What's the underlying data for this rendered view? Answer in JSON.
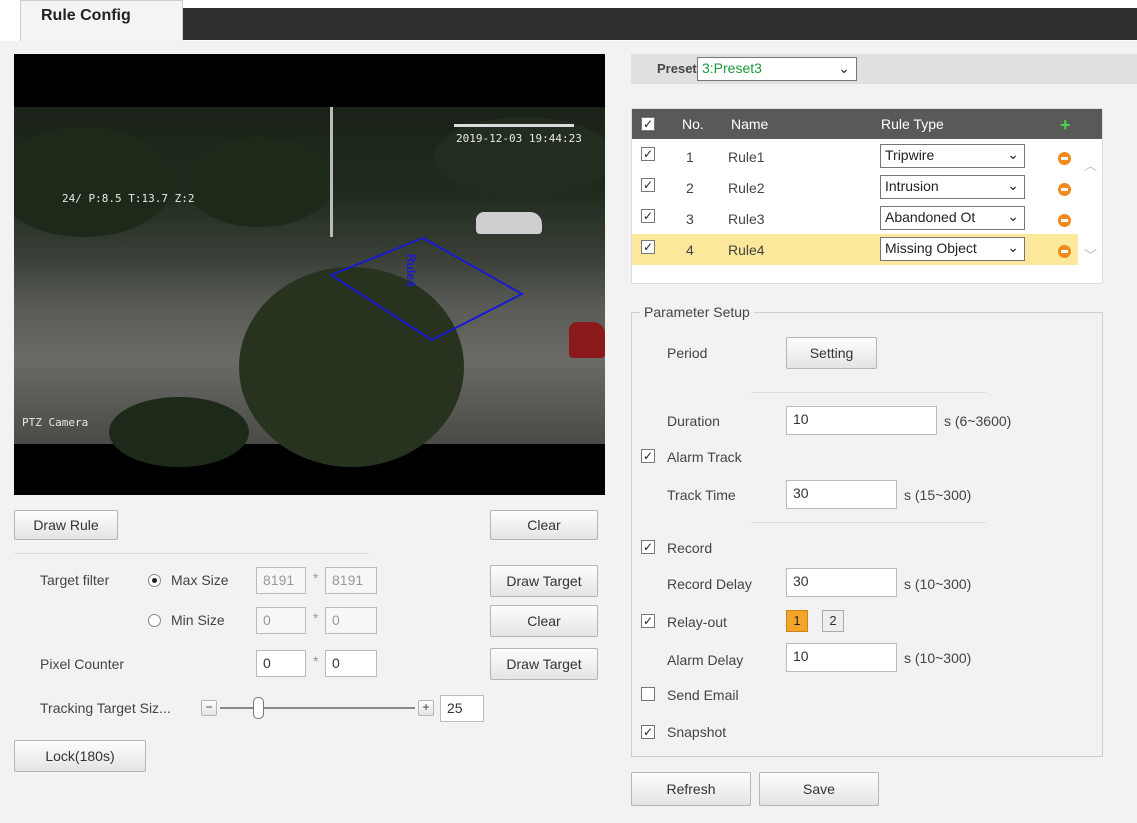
{
  "tab": {
    "title": "Rule Config"
  },
  "video": {
    "timestamp": "2019-12-03 19:44:23",
    "ptz_info": "24/ P:8.5 T:13.7 Z:2",
    "camera_name": "PTZ Camera",
    "rule_label": "Rule4",
    "rule_color": "#1a1ad0"
  },
  "left_controls": {
    "draw_rule": "Draw Rule",
    "clear1": "Clear",
    "target_filter_label": "Target filter",
    "max_size_label": "Max Size",
    "max_w": "8191",
    "max_h": "8191",
    "draw_target1": "Draw Target",
    "min_size_label": "Min Size",
    "min_w": "0",
    "min_h": "0",
    "clear2": "Clear",
    "pixel_counter_label": "Pixel Counter",
    "pix_w": "0",
    "pix_h": "0",
    "draw_target2": "Draw Target",
    "tracking_label": "Tracking Target Siz...",
    "tracking_value": "25",
    "lock": "Lock(180s)",
    "separator": "*"
  },
  "preset": {
    "label": "Preset",
    "value": "3:Preset3"
  },
  "rules_table": {
    "headers": {
      "no": "No.",
      "name": "Name",
      "type": "Rule Type"
    },
    "rows": [
      {
        "no": "1",
        "name": "Rule1",
        "type": "Tripwire",
        "checked": true
      },
      {
        "no": "2",
        "name": "Rule2",
        "type": "Intrusion",
        "checked": true
      },
      {
        "no": "3",
        "name": "Rule3",
        "type": "Abandoned Ot",
        "checked": true
      },
      {
        "no": "4",
        "name": "Rule4",
        "type": "Missing Object",
        "checked": true
      }
    ]
  },
  "params": {
    "legend": "Parameter Setup",
    "period_label": "Period",
    "setting_btn": "Setting",
    "duration_label": "Duration",
    "duration_value": "10",
    "duration_range": "s (6~3600)",
    "alarm_track_label": "Alarm Track",
    "track_time_label": "Track Time",
    "track_time_value": "30",
    "track_time_range": "s (15~300)",
    "record_label": "Record",
    "record_delay_label": "Record Delay",
    "record_delay_value": "30",
    "record_delay_range": "s (10~300)",
    "relay_out_label": "Relay-out",
    "relay_1": "1",
    "relay_2": "2",
    "alarm_delay_label": "Alarm Delay",
    "alarm_delay_value": "10",
    "alarm_delay_range": "s (10~300)",
    "send_email_label": "Send Email",
    "snapshot_label": "Snapshot"
  },
  "footer": {
    "refresh": "Refresh",
    "save": "Save"
  }
}
